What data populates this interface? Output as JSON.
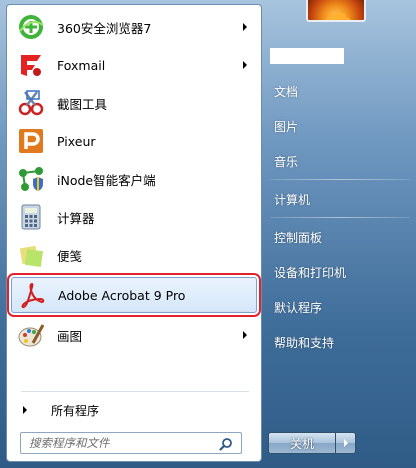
{
  "programs": [
    {
      "label": "360安全浏览器7",
      "icon": "browser-360-icon",
      "submenu": true
    },
    {
      "label": "Foxmail",
      "icon": "foxmail-icon",
      "submenu": true
    },
    {
      "label": "截图工具",
      "icon": "snipping-tool-icon",
      "submenu": false
    },
    {
      "label": "Pixeur",
      "icon": "pixeur-icon",
      "submenu": false
    },
    {
      "label": "iNode智能客户端",
      "icon": "inode-client-icon",
      "submenu": false
    },
    {
      "label": "计算器",
      "icon": "calculator-icon",
      "submenu": false
    },
    {
      "label": "便笺",
      "icon": "sticky-notes-icon",
      "submenu": false
    },
    {
      "label": "Adobe Acrobat 9 Pro",
      "icon": "adobe-acrobat-icon",
      "submenu": false,
      "selected": true
    },
    {
      "label": "画图",
      "icon": "paint-icon",
      "submenu": true
    }
  ],
  "all_programs_label": "所有程序",
  "search": {
    "placeholder": "搜索程序和文件"
  },
  "right_menu": {
    "items": [
      "文档",
      "图片",
      "音乐",
      "计算机",
      "控制面板",
      "设备和打印机",
      "默认程序",
      "帮助和支持"
    ]
  },
  "shutdown_label": "关机",
  "colors": {
    "selection_highlight": "#e3232c",
    "right_text": "#ffffff"
  }
}
